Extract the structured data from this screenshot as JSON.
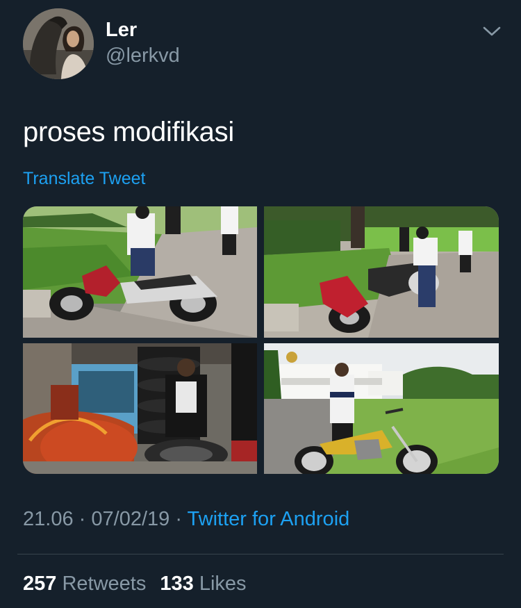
{
  "user": {
    "display_name": "Ler",
    "handle": "@lerkvd"
  },
  "icons": {
    "avatar": "avatar",
    "menu": "chevron-down-icon"
  },
  "tweet": {
    "text": "proses modifikasi",
    "translate_label": "Translate Tweet"
  },
  "media": {
    "photo_count": 4
  },
  "meta": {
    "time": "21.06",
    "separator": "·",
    "date": "07/02/19",
    "source": "Twitter for Android"
  },
  "stats": {
    "retweets_count": "257",
    "retweets_label": "Retweets",
    "likes_count": "133",
    "likes_label": "Likes"
  },
  "colors": {
    "background": "#15202b",
    "primary_text": "#ffffff",
    "secondary_text": "#8899a6",
    "accent": "#1da1f2",
    "divider": "#38444d"
  }
}
